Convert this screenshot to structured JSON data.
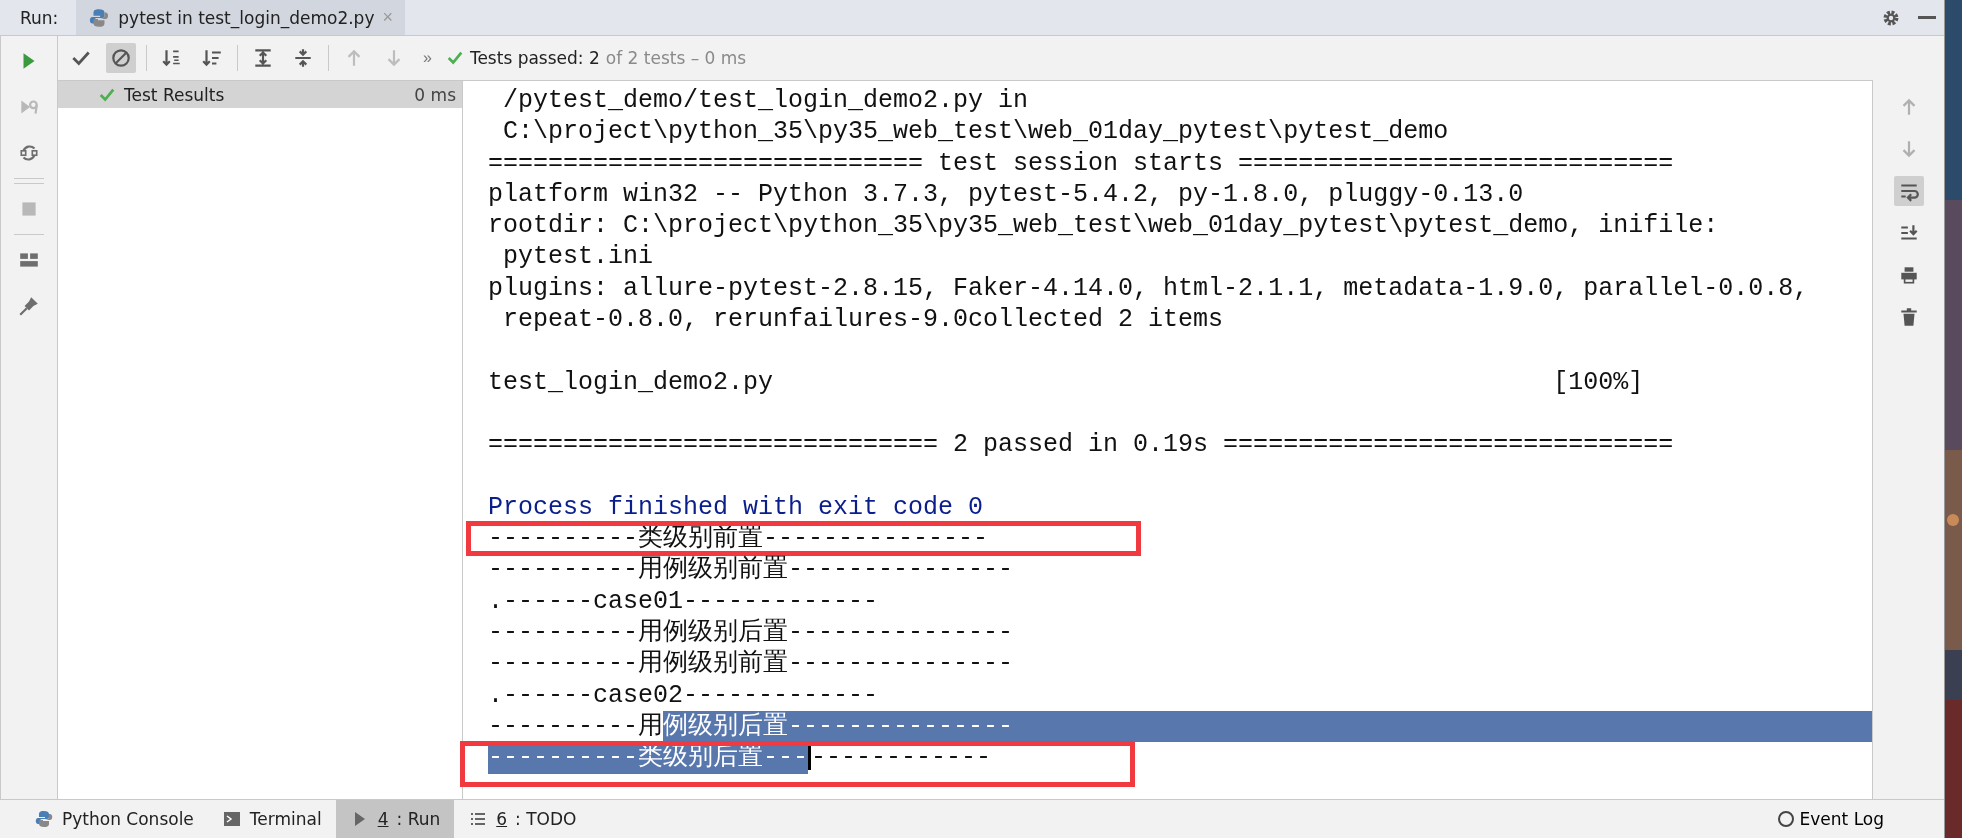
{
  "run_bar": {
    "label": "Run:",
    "tab": {
      "title": "pytest in test_login_demo2.py",
      "close": "×"
    }
  },
  "side_tools": [
    {
      "kind": "run",
      "disabled": false
    },
    {
      "kind": "rerun",
      "disabled": true
    },
    {
      "kind": "toggle",
      "disabled": false
    },
    {
      "kind": "stop",
      "disabled": true
    },
    {
      "kind": "layout",
      "disabled": false
    },
    {
      "kind": "pin",
      "disabled": false
    }
  ],
  "toolbar": {
    "buttons": [
      {
        "kind": "check",
        "disabled": false
      },
      {
        "kind": "cancel",
        "on": true,
        "disabled": false
      },
      {
        "kind": "sort-alpha",
        "disabled": false
      },
      {
        "kind": "sort-duration",
        "disabled": false
      },
      {
        "kind": "expand",
        "disabled": false
      },
      {
        "kind": "collapse",
        "disabled": false
      },
      {
        "kind": "up",
        "disabled": true
      },
      {
        "kind": "down",
        "disabled": true
      }
    ],
    "overflow": "»",
    "status": {
      "kind": "passed",
      "summary": "Tests passed: 2",
      "detail": "of 2 tests – 0 ms"
    }
  },
  "tree": {
    "items": [
      {
        "label": "Test Results",
        "time": "0 ms",
        "selected": true,
        "passed": true
      }
    ]
  },
  "console": {
    "lines": [
      {
        "kind": "cont",
        "text": "/pytest_demo/test_login_demo2.py in"
      },
      {
        "kind": "cont",
        "text": "C:\\project\\python_35\\py35_web_test\\web_01day_pytest\\pytest_demo"
      },
      {
        "kind": "plain",
        "text": "============================= test session starts ============================="
      },
      {
        "kind": "plain",
        "text": "platform win32 -- Python 3.7.3, pytest-5.4.2, py-1.8.0, pluggy-0.13.0"
      },
      {
        "kind": "plain",
        "text": "rootdir: C:\\project\\python_35\\py35_web_test\\web_01day_pytest\\pytest_demo, inifile:"
      },
      {
        "kind": "cont",
        "text": "pytest.ini"
      },
      {
        "kind": "plain",
        "text": "plugins: allure-pytest-2.8.15, Faker-4.14.0, html-2.1.1, metadata-1.9.0, parallel-0.0.8,"
      },
      {
        "kind": "cont",
        "text": "repeat-0.8.0, rerunfailures-9.0collected 2 items"
      },
      {
        "kind": "blank"
      },
      {
        "kind": "progress",
        "text": "test_login_demo2.py",
        "progress": "[100%]"
      },
      {
        "kind": "blank"
      },
      {
        "kind": "plain",
        "text": "============================== 2 passed in 0.19s =============================="
      },
      {
        "kind": "blank"
      },
      {
        "kind": "info",
        "text": "Process finished with exit code 0"
      },
      {
        "kind": "plain",
        "text": "----------类级别前置---------------",
        "boxed": true
      },
      {
        "kind": "plain",
        "text": "----------用例级别前置---------------"
      },
      {
        "kind": "plain",
        "text": ".------case01-------------"
      },
      {
        "kind": "plain",
        "text": "----------用例级别后置---------------"
      },
      {
        "kind": "plain",
        "text": "----------用例级别前置---------------"
      },
      {
        "kind": "plain",
        "text": ".------case02-------------"
      },
      {
        "kind": "segments",
        "segments": [
          {
            "text": "----------用",
            "selected": false
          },
          {
            "text": "例级别后置---------------",
            "selected": true
          }
        ]
      },
      {
        "kind": "segments",
        "boxed": true,
        "segments": [
          {
            "text": "----------类级别后置---",
            "selected": true,
            "caret": true
          },
          {
            "text": "------------",
            "selected": false
          }
        ]
      }
    ]
  },
  "gutter": [
    {
      "kind": "up",
      "selected": false
    },
    {
      "kind": "down",
      "selected": false
    },
    {
      "kind": "wrap",
      "selected": true
    },
    {
      "kind": "scroll-end",
      "selected": false
    },
    {
      "kind": "print",
      "selected": false
    },
    {
      "kind": "delete",
      "selected": false
    }
  ],
  "bottom_tabs": [
    {
      "kind": "python",
      "label": "Python Console",
      "selected": false
    },
    {
      "kind": "terminal",
      "label": "Terminal",
      "selected": false
    },
    {
      "kind": "run",
      "mnemonic": "4",
      "label": ": Run",
      "selected": true
    },
    {
      "kind": "todo",
      "mnemonic": "6",
      "label": ": TODO",
      "selected": false
    }
  ],
  "event_log": "Event Log"
}
